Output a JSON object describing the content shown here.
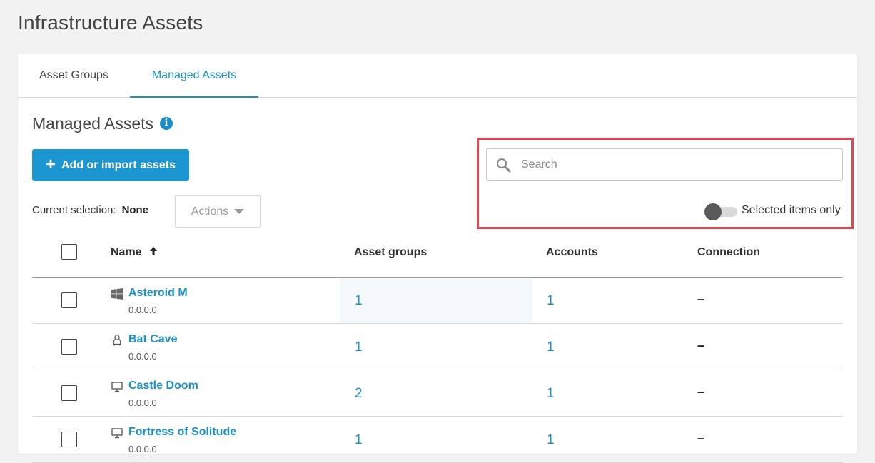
{
  "page": {
    "title": "Infrastructure Assets"
  },
  "tabs": [
    {
      "label": "Asset Groups",
      "active": false
    },
    {
      "label": "Managed Assets",
      "active": true
    }
  ],
  "section": {
    "title": "Managed Assets",
    "info_icon": "info-icon"
  },
  "toolbar": {
    "add_label": "Add or import assets",
    "add_icon": "plus-icon",
    "current_selection_label": "Current selection:",
    "current_selection_value": "None",
    "actions_label": "Actions"
  },
  "search": {
    "placeholder": "Search",
    "value": "",
    "icon": "search-icon"
  },
  "filter": {
    "selected_only_label": "Selected items only",
    "selected_only": false
  },
  "table": {
    "columns": [
      "Name",
      "Asset groups",
      "Accounts",
      "Connection"
    ],
    "sort": {
      "column": "Name",
      "direction": "ascending"
    },
    "rows": [
      {
        "name": "Asteroid M",
        "ip": "0.0.0.0",
        "os_icon": "windows-icon",
        "asset_groups": "1",
        "accounts": "1",
        "connection": "–"
      },
      {
        "name": "Bat Cave",
        "ip": "0.0.0.0",
        "os_icon": "linux-icon",
        "asset_groups": "1",
        "accounts": "1",
        "connection": "–"
      },
      {
        "name": "Castle Doom",
        "ip": "0.0.0.0",
        "os_icon": "monitor-icon",
        "asset_groups": "2",
        "accounts": "1",
        "connection": "–"
      },
      {
        "name": "Fortress of Solitude",
        "ip": "0.0.0.0",
        "os_icon": "monitor-icon",
        "asset_groups": "1",
        "accounts": "1",
        "connection": "–"
      }
    ]
  },
  "colors": {
    "accent": "#1b8fc9",
    "button": "#1b96d0",
    "highlight_border": "#e0474f"
  }
}
